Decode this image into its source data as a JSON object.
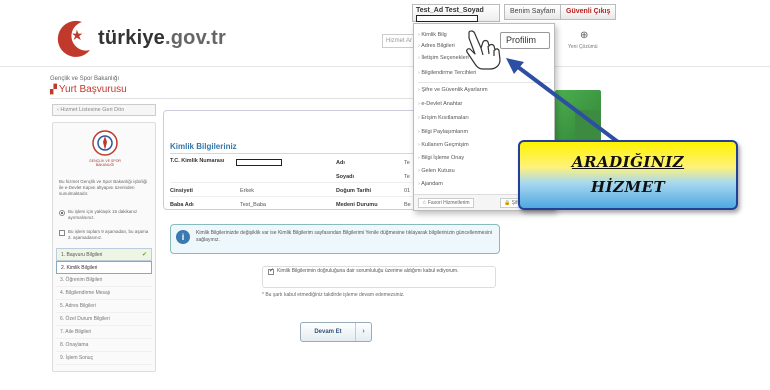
{
  "header": {
    "logo_text": "türkiye",
    "logo_tld": ".gov.tr",
    "user_name": "Test_Ad Test_Soyad",
    "my_account_label": "Benim Sayfam",
    "logout_label": "Güvenli Çıkış",
    "search_placeholder": "Hizmet Ar",
    "language_label": "Yeni Çözümü"
  },
  "page": {
    "ministry": "Gençlik ve Spor Bakanlığı",
    "title": "Yurt Başvurusu",
    "back_link": "Hizmet Listesine Geri Dön"
  },
  "left_panel": {
    "emblem_caption": "GENÇLİK VE SPOR BAKANLIĞI",
    "description": "Bu hizmet Gençlik ve Spor Bakanlığı işbirliği ile e-Devlet Kapısı altyapısı üzerinden sunulmaktadır.",
    "radio_1": "Bu işlem için yaklaşık 15 dakikanız ayırmalısınız.",
    "radio_2": "Bu işlem toplam 9 aşamadan, bu aşama 2. aşamadasınız.",
    "steps": [
      "1. Başvuru Bilgileri",
      "2. Kimlik Bilgileri",
      "3. Öğrenim Bilgileri",
      "4. Bilgilendirme Mesajı",
      "5. Adres Bilgileri",
      "6. Özel Durum Bilgileri",
      "7. Aile Bilgileri",
      "8. Onaylama",
      "9. İşlem Sonuç"
    ]
  },
  "form": {
    "section_title": "Kimlik Bilgileriniz",
    "tc_label": "T.C. Kimlik Numarası",
    "ad_label": "Adı",
    "ad_value": "Te",
    "soyad_label": "Soyadı",
    "soyad_value": "Te",
    "cinsiyet_label": "Cinsiyeti",
    "cinsiyet_value": "Erkek",
    "dogum_label": "Doğum Tarihi",
    "dogum_value": "01",
    "baba_label": "Baba Adı",
    "baba_value": "Test_Baba",
    "medeni_label": "Medeni Durumu",
    "medeni_value": "Be",
    "info_text": "Kimlik Bilgilerinizde değişiklik var ise Kimlik Bilgilerim sayfasından Bilgilerimi Yenile düğmesine tıklayarak bilgilerinizin güncellenmesini sağlayınız.",
    "consent_text": "Kimlik Bilgilerimin doğruluğuna dair sorumluluğu üzerime aldığımı kabul ediyorum.",
    "consent_note": "* Bu şartı kabul etmediğiniz takdirde işleme devam edemezsiniz.",
    "continue_label": "Devam Et",
    "continue_arrow": "›"
  },
  "dropdown": {
    "items": [
      "Kimlik Bilg",
      "Adres Bilgileri",
      "İletişim Seçenekleri",
      "Bilgilendirme Tercihleri",
      "Şifre ve Güvenlik Ayarlarım",
      "e-Devlet Anahtar",
      "Erişim Kısıtlamaları",
      "Bilgi Paylaşımlarım",
      "Kullanım Geçmişim",
      "Bilgi İşleme Onay",
      "Gelen Kutusu",
      "Ajandam"
    ],
    "favorites_label": "Favori Hizmetlerim",
    "password_label": "Şifre",
    "profil_label": "Profilim"
  },
  "callout": {
    "line1": "ARADIĞINIZ",
    "line2": "HİZMET"
  },
  "colors": {
    "brand_red": "#c0392b",
    "link_blue": "#3377aa",
    "callout_border": "#22409a",
    "arrow": "#2c4fa3"
  }
}
